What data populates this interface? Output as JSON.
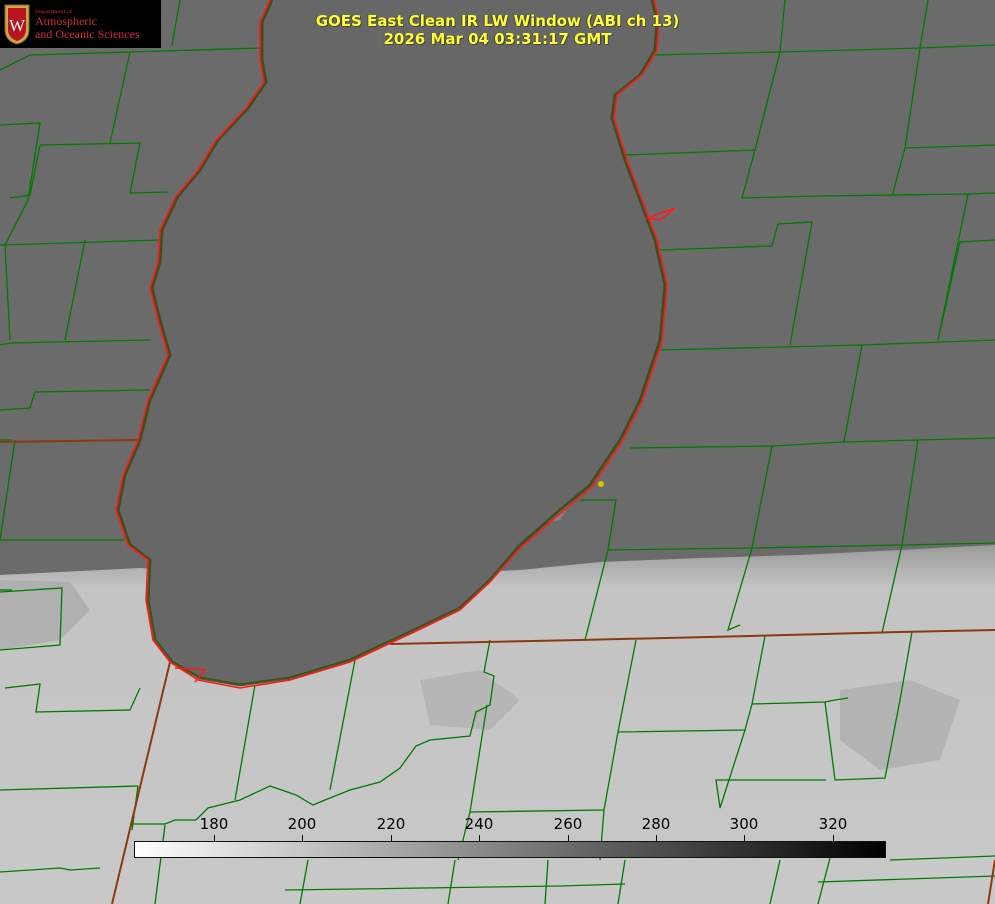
{
  "title": {
    "line1": "GOES East Clean IR LW Window (ABI ch 13)",
    "line2": "2026 Mar 04 03:31:17 GMT"
  },
  "logo": {
    "dept": "Department of",
    "line1": "Atmospheric",
    "line2": "and Oceanic Sciences",
    "shield_letter": "W",
    "text_color": "#d42a3a"
  },
  "colorbar": {
    "min": 162,
    "max": 332,
    "gradient": [
      "#ffffff",
      "#000000"
    ],
    "ticks": [
      {
        "value": 180,
        "label": "180"
      },
      {
        "value": 200,
        "label": "200"
      },
      {
        "value": 220,
        "label": "220"
      },
      {
        "value": 240,
        "label": "240"
      },
      {
        "value": 260,
        "label": "260"
      },
      {
        "value": 280,
        "label": "280"
      },
      {
        "value": 300,
        "label": "300"
      },
      {
        "value": 320,
        "label": "320"
      }
    ]
  },
  "colors": {
    "cloud_free": "#6a6a6a",
    "lake": "#686868",
    "cloud_top": "#c0c0c0",
    "county_lines": "#007a00",
    "coastline_red": "#ff1a1a",
    "state_border": "#8a3a10",
    "title_yellow": "#ffff33",
    "marker": "#d4c400"
  },
  "icons": {
    "logo": "uw-crest-icon",
    "site_marker": "station-dot-icon"
  }
}
